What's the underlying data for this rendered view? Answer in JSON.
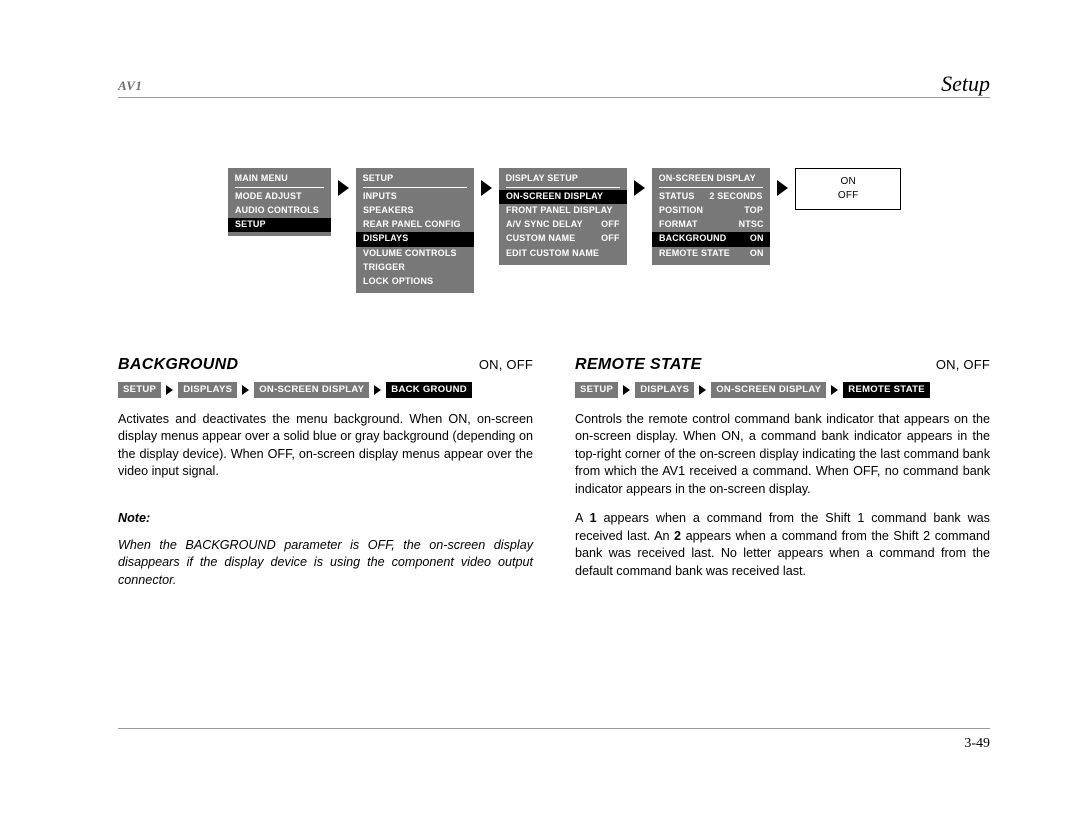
{
  "header": {
    "left_title": "AV1",
    "right_title": "Setup"
  },
  "menu_flow": {
    "boxes": [
      {
        "title": "MAIN MENU",
        "style": "menu",
        "rows": [
          {
            "label": "MODE ADJUST",
            "value": "",
            "highlight": false
          },
          {
            "label": "AUDIO CONTROLS",
            "value": "",
            "highlight": false
          },
          {
            "label": "SETUP",
            "value": "",
            "highlight": true
          }
        ]
      },
      {
        "title": "SETUP",
        "style": "menu",
        "rows": [
          {
            "label": "INPUTS",
            "value": "",
            "highlight": false
          },
          {
            "label": "SPEAKERS",
            "value": "",
            "highlight": false
          },
          {
            "label": "REAR PANEL CONFIG",
            "value": "",
            "highlight": false
          },
          {
            "label": "DISPLAYS",
            "value": "",
            "highlight": true
          },
          {
            "label": "VOLUME CONTROLS",
            "value": "",
            "highlight": false
          },
          {
            "label": "TRIGGER",
            "value": "",
            "highlight": false
          },
          {
            "label": "LOCK OPTIONS",
            "value": "",
            "highlight": false
          }
        ]
      },
      {
        "title": "DISPLAY SETUP",
        "style": "menu",
        "rows": [
          {
            "label": "ON-SCREEN DISPLAY",
            "value": "",
            "highlight": true
          },
          {
            "label": "FRONT PANEL DISPLAY",
            "value": "",
            "highlight": false
          },
          {
            "label": "A/V SYNC DELAY",
            "value": "OFF",
            "highlight": false
          },
          {
            "label": "CUSTOM NAME",
            "value": "OFF",
            "highlight": false
          },
          {
            "label": "EDIT CUSTOM NAME",
            "value": "",
            "highlight": false
          }
        ]
      },
      {
        "title": "ON-SCREEN DISPLAY",
        "style": "menu",
        "rows": [
          {
            "label": "STATUS",
            "value": "2 SECONDS",
            "highlight": false
          },
          {
            "label": "POSITION",
            "value": "TOP",
            "highlight": false
          },
          {
            "label": "FORMAT",
            "value": "NTSC",
            "highlight": false
          },
          {
            "label": "BACKGROUND",
            "value": "ON",
            "highlight": true
          },
          {
            "label": "REMOTE STATE",
            "value": "ON",
            "highlight": false
          }
        ]
      },
      {
        "title": "",
        "style": "plain",
        "rows": [
          {
            "label": "ON",
            "value": "",
            "highlight": false
          },
          {
            "label": "OFF",
            "value": "",
            "highlight": false
          }
        ]
      }
    ]
  },
  "left_column": {
    "title": "BACKGROUND",
    "values": "ON, OFF",
    "breadcrumb": [
      "SETUP",
      "DISPLAYS",
      "ON-SCREEN DISPLAY",
      "BACK GROUND"
    ],
    "paragraph": "Activates and deactivates the menu background. When ON, on-screen display menus appear over a solid blue or gray background (depending on the display device). When OFF, on-screen display menus appear over the video input signal.",
    "note_label": "Note:",
    "note_text": "When the BACKGROUND parameter is OFF, the on-screen display disappears if the display device is using the component video output connector."
  },
  "right_column": {
    "title": "REMOTE STATE",
    "values": "ON, OFF",
    "breadcrumb": [
      "SETUP",
      "DISPLAYS",
      "ON-SCREEN DISPLAY",
      "REMOTE  STATE"
    ],
    "paragraph1": "Controls the remote control command bank indicator that appears on the on-screen display. When ON, a command bank indicator appears in the top-right corner of the on-screen display indicating the last command bank from which the AV1 received a command. When OFF, no command bank indicator appears in the on-screen display.",
    "paragraph2_parts": {
      "a": "A ",
      "bold1": "1",
      "b": " appears when a command from the Shift 1 command bank was received last. An ",
      "bold2": "2",
      "c": " appears when a command from the Shift 2 command bank was received last. No letter appears when a command from the default command bank was received last."
    }
  },
  "footer": {
    "page_number": "3-49"
  }
}
